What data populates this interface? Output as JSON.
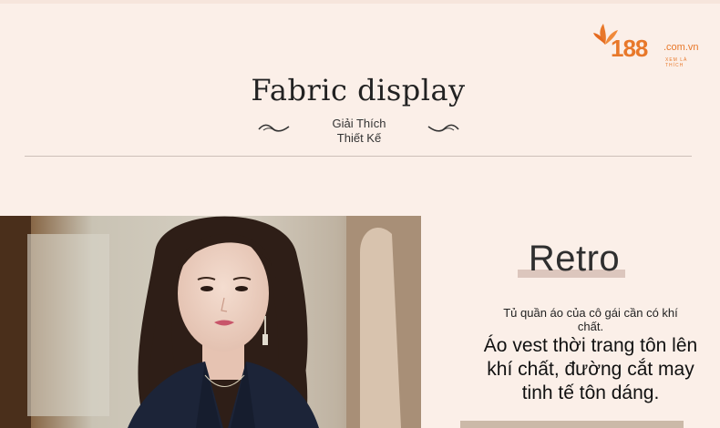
{
  "logo": {
    "number": "188",
    "domain": ".com.vn",
    "slogan": "XEM LÀ THÍCH",
    "brand_color": "#e8782a"
  },
  "header": {
    "title": "Fabric display",
    "subtitle_line1": "Giải Thích",
    "subtitle_line2": "Thiết Kế"
  },
  "product_photo": {
    "subject": "model-wearing-navy-blazer"
  },
  "detail": {
    "heading": "Retro",
    "tagline": "Tủ quần áo của cô gái cần có khí chất.",
    "description": "Áo vest thời trang tôn lên khí chất, đường cắt may tinh tế tôn dáng."
  },
  "colors": {
    "background": "#fbefe8",
    "heading_bar": "#dcc6bd",
    "blazer": "#1c2438"
  }
}
